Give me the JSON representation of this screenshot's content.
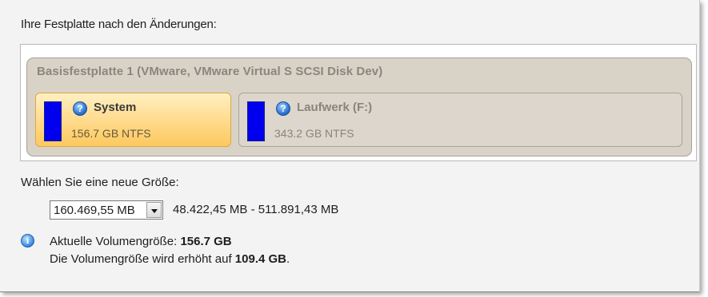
{
  "section_title": "Ihre Festplatte nach den Änderungen:",
  "disk": {
    "name": "Basisfestplatte 1 (VMware, VMware Virtual S SCSI Disk Dev)",
    "partitions": [
      {
        "name": "System",
        "size": "156.7 GB NTFS",
        "selected": true,
        "bar_color": "#0000ee",
        "icon": "question-icon"
      },
      {
        "name": "Laufwerk (F:)",
        "size": "343.2 GB NTFS",
        "selected": false,
        "bar_color": "#0000ee",
        "icon": "question-icon"
      }
    ]
  },
  "resize": {
    "label": "Wählen Sie eine neue Größe:",
    "value": "160.469,55 MB",
    "range": "48.422,45 MB - 511.891,43 MB"
  },
  "info": {
    "icon": "info-icon",
    "current_prefix": "Aktuelle Volumengröße: ",
    "current_value": "156.7 GB",
    "increase_prefix": "Die Volumengröße wird erhöht auf ",
    "increase_value": "109.4 GB",
    "increase_suffix": "."
  }
}
